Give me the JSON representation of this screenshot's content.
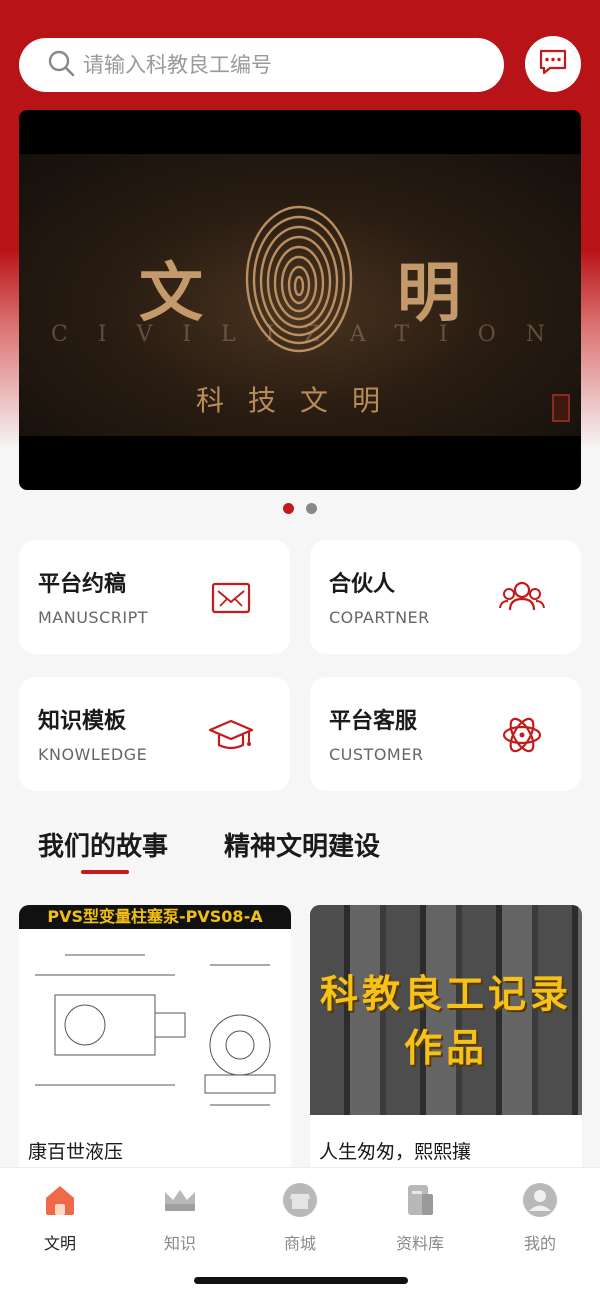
{
  "search": {
    "placeholder": "请输入科教良工编号"
  },
  "banner": {
    "left_char": "文",
    "right_char": "明",
    "latin": "CIVILIZATION",
    "subtitle": "科技文明",
    "page_count": 2,
    "active_page": 1
  },
  "cards": [
    {
      "title": "平台约稿",
      "subtitle": "MANUSCRIPT",
      "icon": "envelope-icon"
    },
    {
      "title": "合伙人",
      "subtitle": "COPARTNER",
      "icon": "partners-icon"
    },
    {
      "title": "知识模板",
      "subtitle": "KNOWLEDGE",
      "icon": "graduation-cap-icon"
    },
    {
      "title": "平台客服",
      "subtitle": "CUSTOMER",
      "icon": "atom-icon"
    }
  ],
  "tabs": [
    {
      "label": "我们的故事",
      "active": true
    },
    {
      "label": "精神文明建设",
      "active": false
    }
  ],
  "stories": [
    {
      "title": "康百世液压",
      "thumb_header": "PVS型变量柱塞泵-PVS08-A"
    },
    {
      "title": "人生匆匆，熙熙攘",
      "thumb_line1": "科教良工记录",
      "thumb_line2": "作品"
    }
  ],
  "nav": [
    {
      "label": "文明",
      "icon": "home-icon",
      "active": true
    },
    {
      "label": "知识",
      "icon": "crown-icon",
      "active": false
    },
    {
      "label": "商城",
      "icon": "store-icon",
      "active": false
    },
    {
      "label": "资料库",
      "icon": "book-icon",
      "active": false
    },
    {
      "label": "我的",
      "icon": "user-icon",
      "active": false
    }
  ],
  "colors": {
    "brand_red": "#b81418",
    "accent_red": "#c41a1a"
  }
}
